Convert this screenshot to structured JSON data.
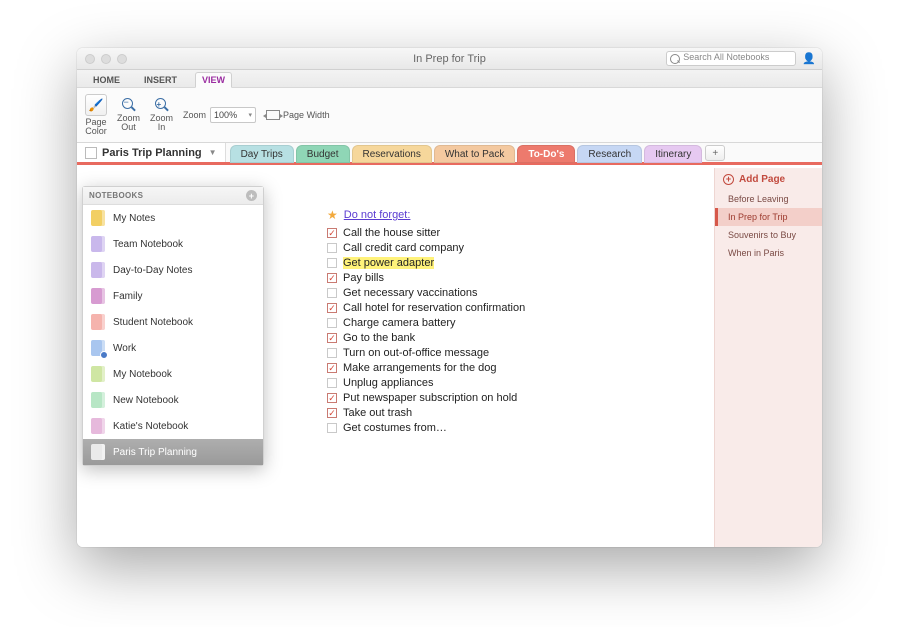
{
  "window": {
    "title": "In Prep for Trip"
  },
  "search": {
    "placeholder": "Search All Notebooks"
  },
  "ribbon_tabs": {
    "home": "HOME",
    "insert": "INSERT",
    "view": "VIEW"
  },
  "ribbon": {
    "page_color": "Page\nColor",
    "zoom_out": "Zoom\nOut",
    "zoom_in": "Zoom\nIn",
    "zoom_label": "Zoom",
    "zoom_value": "100%",
    "page_width": "Page Width"
  },
  "notebook": {
    "name": "Paris Trip Planning"
  },
  "sections": [
    {
      "label": "Day Trips",
      "bg": "#b7e0e3",
      "active": false
    },
    {
      "label": "Budget",
      "bg": "#8fd6b6",
      "active": false
    },
    {
      "label": "Reservations",
      "bg": "#f6d79b",
      "active": false
    },
    {
      "label": "What to Pack",
      "bg": "#f4c9a0",
      "active": false
    },
    {
      "label": "To-Do's",
      "bg": "#ed7a6d",
      "active": true
    },
    {
      "label": "Research",
      "bg": "#c6d7f4",
      "active": false
    },
    {
      "label": "Itinerary",
      "bg": "#e6c9f1",
      "active": false
    }
  ],
  "pages_panel": {
    "add_label": "Add Page",
    "items": [
      {
        "label": "Before Leaving",
        "active": false
      },
      {
        "label": "In Prep for Trip",
        "active": true
      },
      {
        "label": "Souvenirs to Buy",
        "active": false
      },
      {
        "label": "When in Paris",
        "active": false
      }
    ]
  },
  "notebooks_dropdown": {
    "header": "NOTEBOOKS",
    "items": [
      {
        "label": "My Notes",
        "color": "#f2cf63",
        "selected": false,
        "badge": false
      },
      {
        "label": "Team Notebook",
        "color": "#c9b8ec",
        "selected": false,
        "badge": false
      },
      {
        "label": "Day-to-Day Notes",
        "color": "#cab8eb",
        "selected": false,
        "badge": false
      },
      {
        "label": "Family",
        "color": "#d79bd1",
        "selected": false,
        "badge": false
      },
      {
        "label": "Student Notebook",
        "color": "#f5b3ad",
        "selected": false,
        "badge": false
      },
      {
        "label": "Work",
        "color": "#a9c6ef",
        "selected": false,
        "badge": true
      },
      {
        "label": "My Notebook",
        "color": "#cfe6a3",
        "selected": false,
        "badge": false
      },
      {
        "label": "New Notebook",
        "color": "#b7e6c5",
        "selected": false,
        "badge": false
      },
      {
        "label": "Katie's Notebook",
        "color": "#e6b9dc",
        "selected": false,
        "badge": false
      },
      {
        "label": "Paris Trip Planning",
        "color": "#eaeaea",
        "selected": true,
        "badge": false
      }
    ]
  },
  "content": {
    "heading": "Do not forget:",
    "tasks": [
      {
        "text": "Call the house sitter",
        "checked": true,
        "highlight": false
      },
      {
        "text": "Call credit card company",
        "checked": false,
        "highlight": false
      },
      {
        "text": "Get power adapter",
        "checked": false,
        "highlight": true
      },
      {
        "text": "Pay bills",
        "checked": true,
        "highlight": false
      },
      {
        "text": "Get necessary vaccinations",
        "checked": false,
        "highlight": false
      },
      {
        "text": "Call hotel for reservation confirmation",
        "checked": true,
        "highlight": false
      },
      {
        "text": "Charge camera battery",
        "checked": false,
        "highlight": false
      },
      {
        "text": "Go to the bank",
        "checked": true,
        "highlight": false
      },
      {
        "text": "Turn on out-of-office message",
        "checked": false,
        "highlight": false
      },
      {
        "text": "Make arrangements for the dog",
        "checked": true,
        "highlight": false
      },
      {
        "text": "Unplug appliances",
        "checked": false,
        "highlight": false
      },
      {
        "text": "Put newspaper subscription on hold",
        "checked": true,
        "highlight": false
      },
      {
        "text": "Take out trash",
        "checked": true,
        "highlight": false
      },
      {
        "text": "Get costumes from…",
        "checked": false,
        "highlight": false
      }
    ]
  }
}
